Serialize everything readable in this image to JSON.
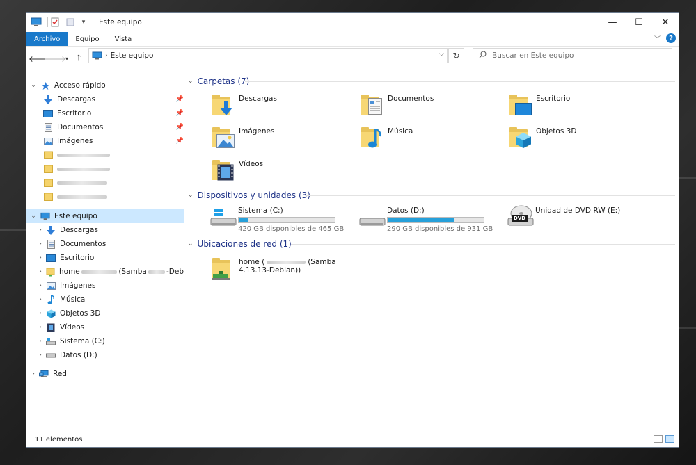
{
  "window": {
    "title": "Este equipo"
  },
  "controls": {
    "minimize": "—",
    "maximize": "☐",
    "close": "✕"
  },
  "ribbon": {
    "tabs": [
      "Archivo",
      "Equipo",
      "Vista"
    ],
    "help": "?"
  },
  "address": {
    "location": "Este equipo"
  },
  "search": {
    "placeholder": "Buscar en Este equipo"
  },
  "sidebar": {
    "quick_access": {
      "label": "Acceso rápido",
      "items": [
        {
          "label": "Descargas",
          "icon": "download-arrow-icon"
        },
        {
          "label": "Escritorio",
          "icon": "desktop-icon"
        },
        {
          "label": "Documentos",
          "icon": "document-icon"
        },
        {
          "label": "Imágenes",
          "icon": "pictures-icon"
        }
      ]
    },
    "this_pc": {
      "label": "Este equipo",
      "items": [
        {
          "label": "Descargas",
          "icon": "download-arrow-icon"
        },
        {
          "label": "Documentos",
          "icon": "document-icon"
        },
        {
          "label": "Escritorio",
          "icon": "desktop-icon"
        },
        {
          "label": "home",
          "label_mid": "(Samba",
          "label_end": "-Deb",
          "icon": "network-folder-icon"
        },
        {
          "label": "Imágenes",
          "icon": "pictures-icon"
        },
        {
          "label": "Música",
          "icon": "music-note-icon"
        },
        {
          "label": "Objetos 3D",
          "icon": "cube-3d-icon"
        },
        {
          "label": "Vídeos",
          "icon": "video-icon"
        },
        {
          "label": "Sistema (C:)",
          "icon": "system-drive-icon"
        },
        {
          "label": "Datos (D:)",
          "icon": "hard-drive-icon"
        }
      ]
    },
    "network": {
      "label": "Red"
    }
  },
  "content": {
    "folders": {
      "header": "Carpetas (7)",
      "items": [
        "Descargas",
        "Documentos",
        "Escritorio",
        "Imágenes",
        "Música",
        "Objetos 3D",
        "Vídeos"
      ]
    },
    "devices": {
      "header": "Dispositivos y unidades (3)",
      "drives": [
        {
          "label": "Sistema (C:)",
          "free": "420 GB disponibles de 465 GB",
          "used_fraction": 0.097
        },
        {
          "label": "Datos (D:)",
          "free": "290 GB disponibles de 931 GB",
          "used_fraction": 0.689
        },
        {
          "label": "Unidad de DVD RW (E:)",
          "badge": "DVD"
        }
      ]
    },
    "network": {
      "header": "Ubicaciones de red (1)",
      "item": {
        "line1_start": "home (",
        "line1_end": "(Samba",
        "line2": "4.13.13-Debian))"
      }
    }
  },
  "status": {
    "count": "11 elementos"
  },
  "colors": {
    "accent": "#1979ca",
    "selection": "#cce8ff",
    "group_header": "#1e3287",
    "drive_bar": "#26a0da"
  }
}
